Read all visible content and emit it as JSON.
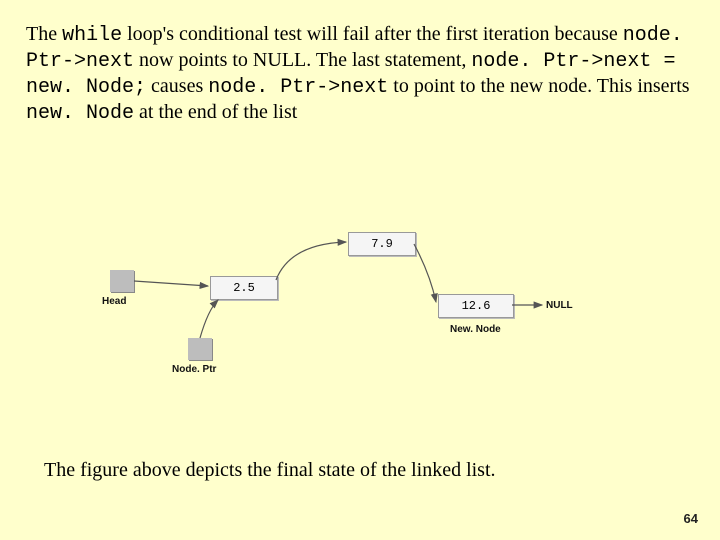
{
  "para": {
    "t1": "The ",
    "t2": "while",
    "t3": " loop's conditional test will fail after the first iteration because ",
    "t4": "node. Ptr->next",
    "t5": " now points to NULL. The last statement, ",
    "t6": "node. Ptr->next = new. Node;",
    "t7": " causes ",
    "t8": "node. Ptr->next",
    "t9": " to point to the new node. This inserts ",
    "t10": "new. Node",
    "t11": " at the end of the list"
  },
  "diagram": {
    "head_label": "Head",
    "nodeptr_label": "Node. Ptr",
    "newnode_label": "New. Node",
    "null_label": "NULL",
    "n1": "2.5",
    "n2": "7.9",
    "n3": "12.6"
  },
  "caption": "The figure above depicts the final state of the linked list.",
  "page": "64"
}
